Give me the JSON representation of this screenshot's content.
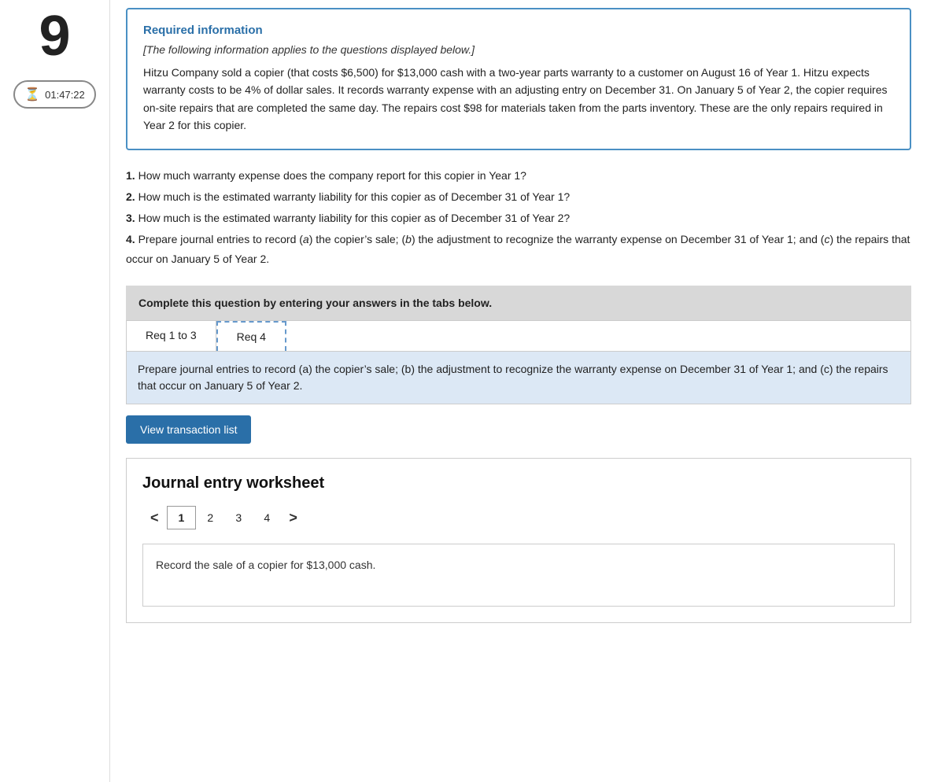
{
  "sidebar": {
    "question_number": "9",
    "timer_label": "01:47:22"
  },
  "required_info": {
    "title": "Required information",
    "subtitle": "[The following information applies to the questions displayed below.]",
    "body": "Hitzu Company sold a copier (that costs $6,500) for $13,000 cash with a two-year parts warranty to a customer on August 16 of Year 1. Hitzu expects warranty costs to be 4% of dollar sales. It records warranty expense with an adjusting entry on December 31. On January 5 of Year 2, the copier requires on-site repairs that are completed the same day. The repairs cost $98 for materials taken from the parts inventory. These are the only repairs required in Year 2 for this copier."
  },
  "questions": [
    {
      "number": "1",
      "text": "How much warranty expense does the company report for this copier in Year 1?"
    },
    {
      "number": "2",
      "text": "How much is the estimated warranty liability for this copier as of December 31 of Year 1?"
    },
    {
      "number": "3",
      "text": "How much is the estimated warranty liability for this copier as of December 31 of Year 2?"
    },
    {
      "number": "4",
      "text": "Prepare journal entries to record (a) the copier’s sale; (b) the adjustment to recognize the warranty expense on December 31 of Year 1; and (c) the repairs that occur on January 5 of Year 2."
    }
  ],
  "complete_bar": {
    "label": "Complete this question by entering your answers in the tabs below."
  },
  "tabs": [
    {
      "label": "Req 1 to 3",
      "active": false
    },
    {
      "label": "Req 4",
      "active": true
    }
  ],
  "tab_content": "Prepare journal entries to record (a) the copier’s sale; (b) the adjustment to recognize the warranty expense on December 31 of Year 1; and (c) the repairs that occur on January 5 of Year 2.",
  "view_transaction_button": "View transaction list",
  "journal_worksheet": {
    "title": "Journal entry worksheet",
    "pages": [
      "1",
      "2",
      "3",
      "4"
    ],
    "active_page": "1",
    "description": "Record the sale of a copier for $13,000 cash."
  }
}
